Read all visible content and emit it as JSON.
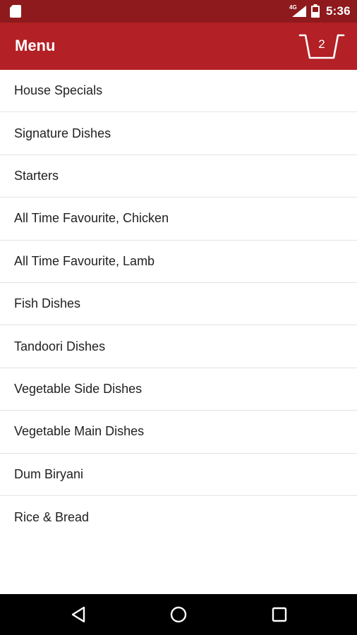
{
  "status_bar": {
    "network": "4G",
    "time": "5:36",
    "icons": [
      "sd-card-icon",
      "signal-icon",
      "battery-icon"
    ]
  },
  "app_bar": {
    "title": "Menu",
    "cart_count": "2",
    "cart_icon": "basket-icon"
  },
  "menu": {
    "items": [
      {
        "label": "House Specials"
      },
      {
        "label": "Signature Dishes"
      },
      {
        "label": "Starters"
      },
      {
        "label": "All Time Favourite, Chicken"
      },
      {
        "label": "All Time Favourite, Lamb"
      },
      {
        "label": "Fish Dishes"
      },
      {
        "label": "Tandoori Dishes"
      },
      {
        "label": "Vegetable Side Dishes"
      },
      {
        "label": "Vegetable Main Dishes"
      },
      {
        "label": "Dum Biryani"
      },
      {
        "label": "Rice & Bread"
      }
    ]
  },
  "nav_bar": {
    "icons": [
      "back-icon",
      "home-icon",
      "recents-icon"
    ]
  },
  "colors": {
    "status_bar": "#8e1a1d",
    "app_bar": "#b32025",
    "text": "#212121",
    "divider": "#e3e3e3",
    "nav_bar": "#000000"
  }
}
